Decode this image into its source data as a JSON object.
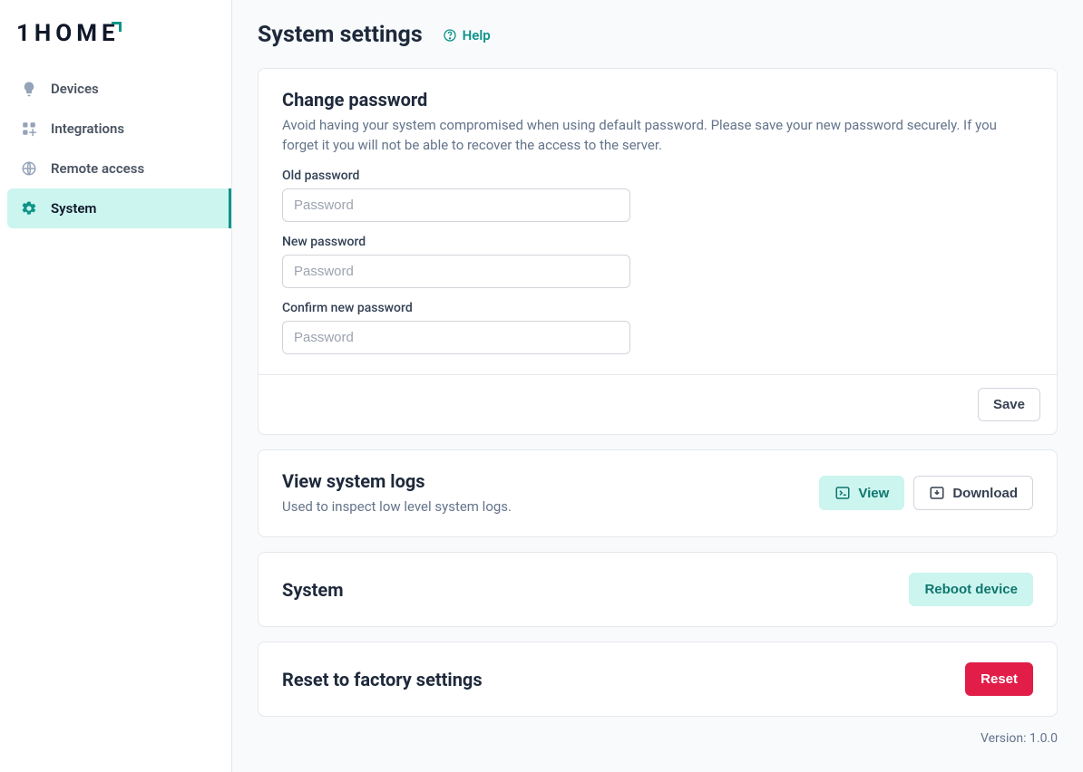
{
  "brand": "1HOME",
  "sidebar": {
    "items": [
      {
        "label": "Devices"
      },
      {
        "label": "Integrations"
      },
      {
        "label": "Remote access"
      },
      {
        "label": "System"
      }
    ]
  },
  "header": {
    "title": "System settings",
    "help_label": "Help"
  },
  "change_password": {
    "title": "Change password",
    "description": "Avoid having your system compromised when using default password. Please save your new password securely. If you forget it you will not be able to recover the access to the server.",
    "old_label": "Old password",
    "new_label": "New password",
    "confirm_label": "Confirm new password",
    "placeholder": "Password",
    "save_label": "Save"
  },
  "logs": {
    "title": "View system logs",
    "description": "Used to inspect low level system logs.",
    "view_label": "View",
    "download_label": "Download"
  },
  "system": {
    "title": "System",
    "reboot_label": "Reboot device"
  },
  "reset": {
    "title": "Reset to factory settings",
    "reset_label": "Reset"
  },
  "footer": {
    "version": "Version: 1.0.0"
  }
}
